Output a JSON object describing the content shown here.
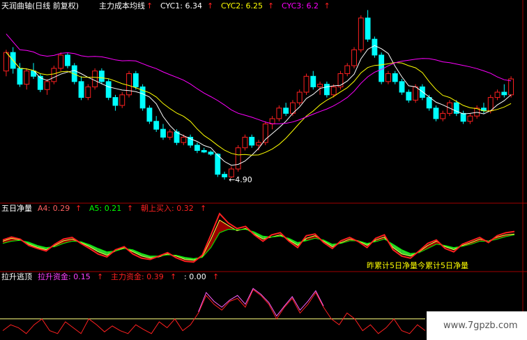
{
  "chart_data": [
    {
      "type": "candlestick",
      "title": "天润曲轴(日线 前复权)",
      "legend": [
        {
          "name": "主力成本均线",
          "value": "",
          "color": "#ffffff"
        },
        {
          "name": "CYC1",
          "value": "6.34",
          "color": "#ffffff"
        },
        {
          "name": "CYC2",
          "value": "6.25",
          "color": "#ffff00"
        },
        {
          "name": "CYC3",
          "value": "6.2",
          "color": "#ff00ff"
        }
      ],
      "low_label": "4.90",
      "ylim": [
        4.6,
        8.0
      ],
      "candles": [
        [
          6.95,
          7.35,
          6.85,
          7.3
        ],
        [
          7.3,
          7.4,
          6.9,
          7.0
        ],
        [
          7.0,
          7.1,
          6.65,
          6.7
        ],
        [
          6.7,
          7.0,
          6.6,
          6.95
        ],
        [
          6.95,
          7.1,
          6.8,
          6.85
        ],
        [
          6.85,
          6.9,
          6.55,
          6.6
        ],
        [
          6.6,
          6.8,
          6.5,
          6.75
        ],
        [
          6.75,
          7.05,
          6.7,
          7.0
        ],
        [
          7.0,
          7.3,
          6.95,
          7.25
        ],
        [
          7.25,
          7.3,
          7.0,
          7.05
        ],
        [
          7.05,
          7.1,
          6.7,
          6.75
        ],
        [
          6.75,
          6.85,
          6.4,
          6.45
        ],
        [
          6.45,
          6.7,
          6.4,
          6.65
        ],
        [
          6.65,
          7.0,
          6.6,
          6.95
        ],
        [
          6.95,
          7.0,
          6.7,
          6.75
        ],
        [
          6.75,
          6.8,
          6.4,
          6.45
        ],
        [
          6.45,
          6.5,
          6.2,
          6.3
        ],
        [
          6.3,
          6.55,
          6.25,
          6.5
        ],
        [
          6.5,
          6.95,
          6.45,
          6.9
        ],
        [
          6.9,
          6.95,
          6.6,
          6.65
        ],
        [
          6.65,
          6.7,
          6.2,
          6.25
        ],
        [
          6.25,
          6.3,
          5.95,
          6.0
        ],
        [
          6.0,
          6.1,
          5.8,
          5.85
        ],
        [
          5.85,
          5.95,
          5.65,
          5.7
        ],
        [
          5.7,
          5.85,
          5.65,
          5.8
        ],
        [
          5.8,
          5.85,
          5.55,
          5.6
        ],
        [
          5.6,
          5.75,
          5.55,
          5.7
        ],
        [
          5.7,
          5.75,
          5.5,
          5.55
        ],
        [
          5.55,
          5.6,
          5.4,
          5.45
        ],
        [
          5.45,
          5.5,
          5.4,
          5.42
        ],
        [
          5.42,
          5.45,
          5.35,
          5.38
        ],
        [
          5.38,
          5.4,
          4.95,
          5.0
        ],
        [
          5.0,
          5.05,
          4.9,
          4.95
        ],
        [
          4.95,
          5.15,
          4.93,
          5.1
        ],
        [
          5.1,
          5.55,
          5.05,
          5.5
        ],
        [
          5.5,
          5.75,
          5.45,
          5.7
        ],
        [
          5.7,
          5.75,
          5.5,
          5.55
        ],
        [
          5.55,
          5.65,
          5.45,
          5.6
        ],
        [
          5.6,
          6.0,
          5.55,
          5.95
        ],
        [
          5.95,
          6.1,
          5.85,
          6.05
        ],
        [
          6.05,
          6.3,
          6.0,
          6.25
        ],
        [
          6.25,
          6.35,
          6.1,
          6.15
        ],
        [
          6.15,
          6.4,
          6.1,
          6.35
        ],
        [
          6.35,
          6.6,
          6.3,
          6.55
        ],
        [
          6.55,
          6.9,
          6.5,
          6.85
        ],
        [
          6.85,
          6.95,
          6.6,
          6.65
        ],
        [
          6.65,
          6.75,
          6.5,
          6.7
        ],
        [
          6.7,
          6.75,
          6.45,
          6.5
        ],
        [
          6.5,
          6.7,
          6.45,
          6.65
        ],
        [
          6.65,
          6.95,
          6.6,
          6.9
        ],
        [
          6.9,
          7.1,
          6.85,
          7.05
        ],
        [
          7.05,
          7.4,
          7.0,
          7.35
        ],
        [
          7.35,
          8.0,
          7.3,
          7.95
        ],
        [
          7.95,
          8.1,
          7.5,
          7.55
        ],
        [
          7.55,
          7.6,
          7.2,
          7.25
        ],
        [
          7.25,
          7.3,
          6.7,
          6.75
        ],
        [
          6.75,
          6.95,
          6.7,
          6.9
        ],
        [
          6.9,
          6.95,
          6.7,
          6.75
        ],
        [
          6.75,
          6.8,
          6.5,
          6.55
        ],
        [
          6.55,
          6.6,
          6.35,
          6.4
        ],
        [
          6.4,
          6.7,
          6.35,
          6.65
        ],
        [
          6.65,
          6.7,
          6.4,
          6.45
        ],
        [
          6.45,
          6.5,
          6.2,
          6.25
        ],
        [
          6.25,
          6.3,
          6.0,
          6.05
        ],
        [
          6.05,
          6.2,
          6.0,
          6.15
        ],
        [
          6.15,
          6.4,
          6.1,
          6.35
        ],
        [
          6.35,
          6.4,
          6.1,
          6.15
        ],
        [
          6.15,
          6.2,
          5.95,
          6.0
        ],
        [
          6.0,
          6.15,
          5.95,
          6.1
        ],
        [
          6.1,
          6.3,
          6.05,
          6.25
        ],
        [
          6.25,
          6.35,
          6.15,
          6.2
        ],
        [
          6.2,
          6.5,
          6.15,
          6.45
        ],
        [
          6.45,
          6.6,
          6.4,
          6.55
        ],
        [
          6.55,
          6.7,
          6.45,
          6.5
        ],
        [
          6.5,
          6.85,
          6.45,
          6.8
        ]
      ]
    },
    {
      "type": "line",
      "title": "五日净量",
      "legend": [
        {
          "name": "A4",
          "value": "0.29",
          "color": "#ff6060"
        },
        {
          "name": "A5",
          "value": "0.21",
          "color": "#00ff00"
        },
        {
          "name": "朝上买入",
          "value": "0.32",
          "color": "#ff2020"
        }
      ],
      "annotation": "昨累计5日净量今累计5日净量",
      "series": [
        {
          "name": "A4",
          "values": [
            0.05,
            0.12,
            0.08,
            -0.02,
            -0.1,
            -0.15,
            -0.05,
            0.06,
            0.1,
            0.02,
            -0.08,
            -0.2,
            -0.28,
            -0.18,
            -0.1,
            -0.2,
            -0.3,
            -0.35,
            -0.32,
            -0.25,
            -0.3,
            -0.38,
            -0.4,
            -0.32,
            0.1,
            0.55,
            0.42,
            0.3,
            0.35,
            0.22,
            0.1,
            0.15,
            0.2,
            0.08,
            -0.05,
            0.12,
            0.18,
            0.05,
            -0.08,
            0.02,
            0.1,
            0.06,
            -0.05,
            0.08,
            0.15,
            -0.1,
            -0.25,
            -0.3,
            -0.2,
            -0.05,
            0.05,
            -0.08,
            -0.15,
            -0.05,
            0.02,
            0.1,
            0.05,
            0.15,
            0.2,
            0.22
          ]
        },
        {
          "name": "A5",
          "values": [
            0.0,
            0.05,
            0.07,
            0.03,
            -0.05,
            -0.1,
            -0.08,
            0.0,
            0.05,
            0.04,
            -0.03,
            -0.12,
            -0.2,
            -0.18,
            -0.12,
            -0.15,
            -0.24,
            -0.3,
            -0.3,
            -0.27,
            -0.28,
            -0.33,
            -0.36,
            -0.33,
            -0.1,
            0.25,
            0.33,
            0.32,
            0.33,
            0.27,
            0.17,
            0.15,
            0.17,
            0.12,
            0.02,
            0.06,
            0.12,
            0.08,
            -0.02,
            0.0,
            0.06,
            0.06,
            0.0,
            0.04,
            0.1,
            -0.02,
            -0.15,
            -0.24,
            -0.22,
            -0.12,
            -0.02,
            -0.05,
            -0.1,
            -0.07,
            -0.02,
            0.05,
            0.05,
            0.1,
            0.16,
            0.2
          ]
        },
        {
          "name": "朝上买入",
          "values": [
            0.08,
            0.15,
            0.1,
            -0.05,
            -0.12,
            -0.18,
            -0.02,
            0.1,
            0.14,
            0.0,
            -0.12,
            -0.25,
            -0.32,
            -0.15,
            -0.08,
            -0.25,
            -0.35,
            -0.38,
            -0.3,
            -0.22,
            -0.34,
            -0.42,
            -0.44,
            -0.28,
            0.2,
            0.7,
            0.48,
            0.35,
            0.4,
            0.2,
            0.05,
            0.2,
            0.25,
            0.05,
            -0.1,
            0.18,
            0.22,
            0.02,
            -0.12,
            0.06,
            0.14,
            0.04,
            -0.1,
            0.12,
            0.2,
            -0.15,
            -0.3,
            -0.35,
            -0.18,
            0.0,
            0.08,
            -0.12,
            -0.2,
            -0.02,
            0.06,
            0.14,
            0.02,
            0.18,
            0.25,
            0.28
          ]
        }
      ],
      "ylim": [
        -0.6,
        0.8
      ]
    },
    {
      "type": "line",
      "title": "拉升逃顶",
      "legend": [
        {
          "name": "拉升资金",
          "value": "0.15",
          "color": "#ff40ff"
        },
        {
          "name": "主力资金",
          "value": "0.39",
          "color": "#ff2020"
        },
        {
          "name": "",
          "value": "0.00",
          "color": "#ffffff"
        }
      ],
      "series": [
        {
          "name": "主力资金",
          "values": [
            0.1,
            0.2,
            0.15,
            0.05,
            0.2,
            0.3,
            0.1,
            0.05,
            0.25,
            0.15,
            0.05,
            0.3,
            0.2,
            0.08,
            0.18,
            0.1,
            0.05,
            0.2,
            0.12,
            0.05,
            0.25,
            0.15,
            0.3,
            0.1,
            0.2,
            0.4,
            0.7,
            0.55,
            0.45,
            0.6,
            0.65,
            0.5,
            0.8,
            0.7,
            0.55,
            0.3,
            0.5,
            0.65,
            0.4,
            0.55,
            0.75,
            0.5,
            0.3,
            0.2,
            0.4,
            0.3,
            0.1,
            0.2,
            0.05,
            0.15,
            0.3,
            0.1,
            0.05,
            0.2,
            0.1
          ]
        },
        {
          "name": "拉升资金",
          "values": [
            null,
            null,
            null,
            null,
            null,
            null,
            null,
            null,
            null,
            null,
            null,
            null,
            null,
            null,
            null,
            null,
            null,
            null,
            null,
            null,
            null,
            null,
            null,
            null,
            null,
            0.42,
            0.75,
            0.6,
            0.5,
            0.62,
            0.7,
            0.55,
            0.82,
            0.72,
            0.58,
            0.35,
            0.52,
            0.68,
            0.45,
            0.6,
            0.78,
            0.52,
            null,
            null,
            null,
            null,
            null,
            null,
            null,
            null,
            null,
            null,
            null,
            null,
            null
          ]
        }
      ],
      "baseline": 0.3,
      "ylim": [
        0.0,
        1.0
      ]
    }
  ],
  "watermark": "www.7gpzb.com"
}
